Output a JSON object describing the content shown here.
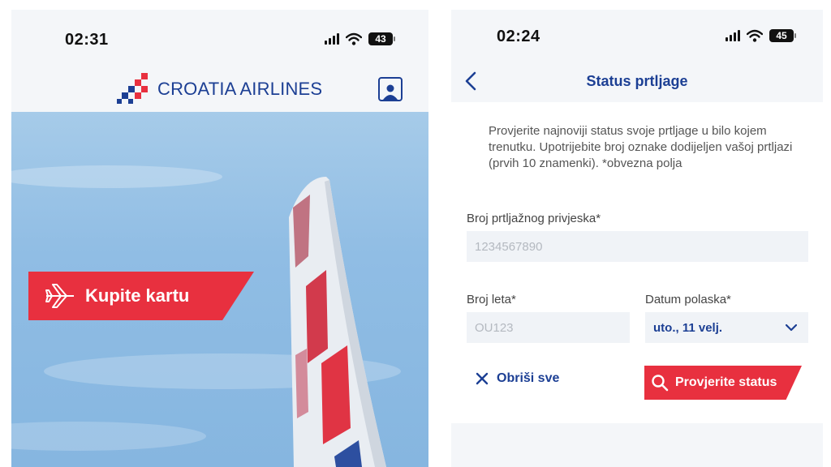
{
  "left": {
    "status_bar": {
      "time": "02:31",
      "battery": "43"
    },
    "brand": {
      "name": "CROATIA AIRLINES"
    },
    "hero": {
      "buy_button_label": "Kupite kartu"
    }
  },
  "right": {
    "status_bar": {
      "time": "02:24",
      "battery": "45"
    },
    "nav": {
      "title": "Status prtljage"
    },
    "intro_text": "Provjerite najnoviji status svoje prtljage u bilo kojem trenutku. Upotrijebite broj oznake dodijeljen vašoj prtljazi (prvih 10 znamenki). *obvezna polja",
    "fields": {
      "tag": {
        "label": "Broj prtljažnog privjeska*",
        "placeholder": "1234567890"
      },
      "flight": {
        "label": "Broj leta*",
        "placeholder": "OU123"
      },
      "date": {
        "label": "Datum polaska*",
        "value": "uto., 11 velj."
      }
    },
    "actions": {
      "clear_label": "Obriši sve",
      "check_label": "Provjerite status"
    }
  },
  "colors": {
    "brand_blue": "#1c3f94",
    "accent_red": "#e8303f",
    "sky": "#90bde4"
  },
  "icons": [
    "signal-icon",
    "wifi-icon",
    "battery-icon",
    "logo-mark",
    "profile-icon",
    "plane-icon",
    "back-chevron-icon",
    "chevron-down-icon",
    "close-icon",
    "search-icon"
  ]
}
